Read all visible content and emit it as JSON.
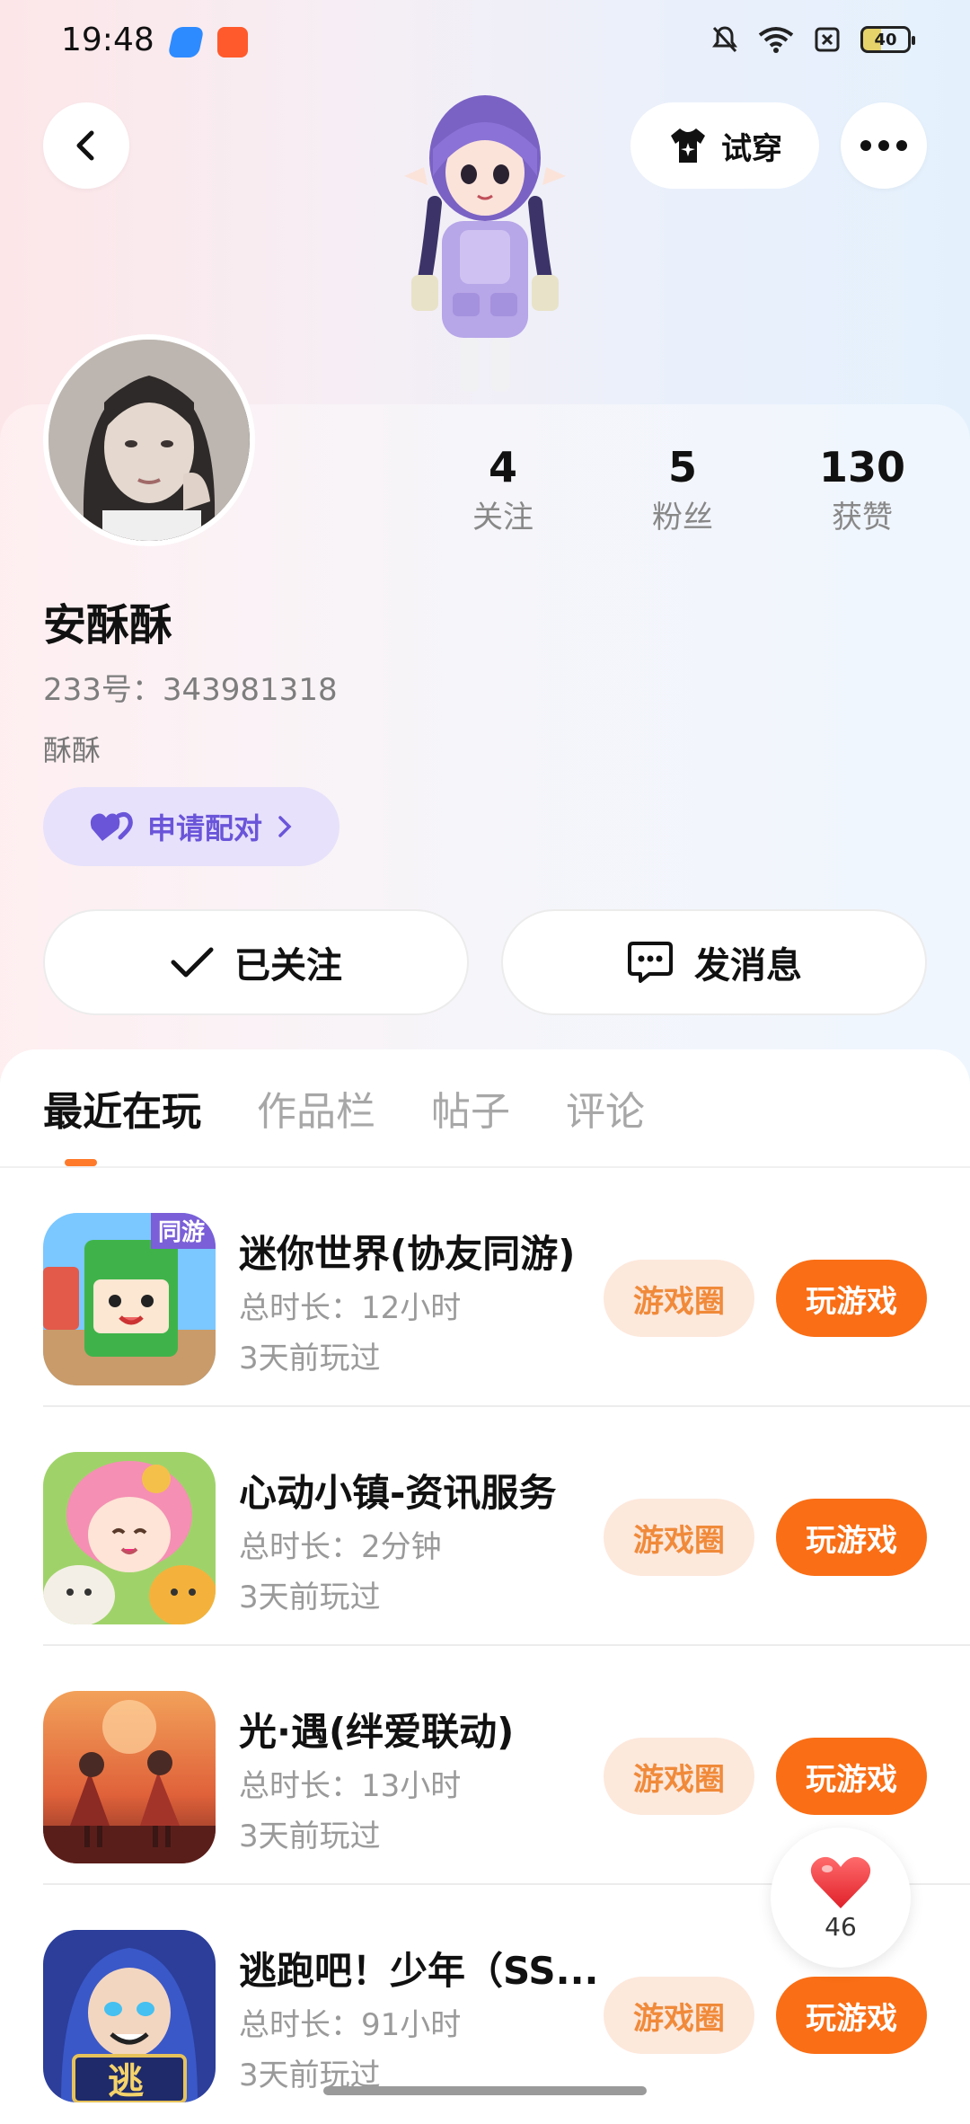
{
  "status_bar": {
    "time": "19:48",
    "battery": "40"
  },
  "header": {
    "try_on_label": "试穿"
  },
  "profile": {
    "name": "安酥酥",
    "uid": "233号：343981318",
    "bio": "酥酥",
    "match_label": "申请配对",
    "stats": [
      {
        "value": "4",
        "label": "关注"
      },
      {
        "value": "5",
        "label": "粉丝"
      },
      {
        "value": "130",
        "label": "获赞"
      }
    ],
    "follow_label": "已关注",
    "message_label": "发消息"
  },
  "tabs": [
    {
      "label": "最近在玩",
      "active": true
    },
    {
      "label": "作品栏"
    },
    {
      "label": "帖子"
    },
    {
      "label": "评论"
    }
  ],
  "games": [
    {
      "name": "迷你世界(协友同游)",
      "duration": "总时长：12小时",
      "last_played": "3天前玩过",
      "circle_label": "游戏圈",
      "play_label": "玩游戏"
    },
    {
      "name": "心动小镇-资讯服务",
      "duration": "总时长：2分钟",
      "last_played": "3天前玩过",
      "circle_label": "游戏圈",
      "play_label": "玩游戏"
    },
    {
      "name": "光·遇(绊爱联动)",
      "duration": "总时长：13小时",
      "last_played": "3天前玩过",
      "circle_label": "游戏圈",
      "play_label": "玩游戏"
    },
    {
      "name": "逃跑吧！少年（SS...",
      "duration": "总时长：91小时",
      "last_played": "3天前玩过",
      "circle_label": "游戏圈",
      "play_label": "玩游戏"
    }
  ],
  "game_icon_texts": [
    "同游",
    "逃"
  ],
  "like": {
    "count": "46"
  },
  "colors": {
    "accent": "#fa6e15",
    "match_purple": "#6a55d9",
    "pill_bg": "#fde8dc"
  }
}
